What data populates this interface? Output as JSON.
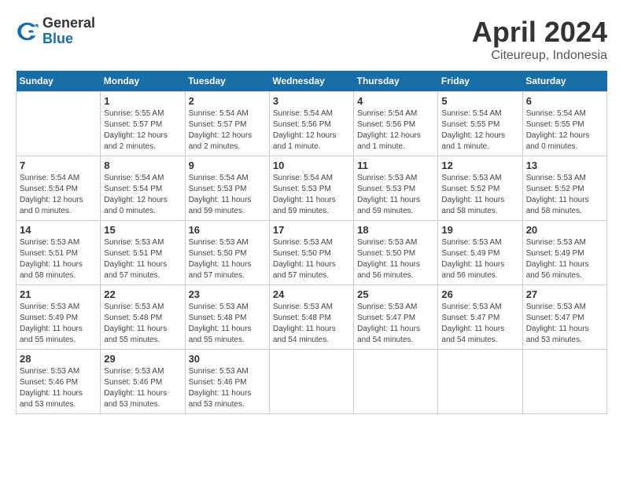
{
  "logo": {
    "general": "General",
    "blue": "Blue"
  },
  "header": {
    "month": "April 2024",
    "location": "Citeureup, Indonesia"
  },
  "weekdays": [
    "Sunday",
    "Monday",
    "Tuesday",
    "Wednesday",
    "Thursday",
    "Friday",
    "Saturday"
  ],
  "weeks": [
    [
      {
        "day": "",
        "sunrise": "",
        "sunset": "",
        "daylight": ""
      },
      {
        "day": "1",
        "sunrise": "Sunrise: 5:55 AM",
        "sunset": "Sunset: 5:57 PM",
        "daylight": "Daylight: 12 hours and 2 minutes."
      },
      {
        "day": "2",
        "sunrise": "Sunrise: 5:54 AM",
        "sunset": "Sunset: 5:57 PM",
        "daylight": "Daylight: 12 hours and 2 minutes."
      },
      {
        "day": "3",
        "sunrise": "Sunrise: 5:54 AM",
        "sunset": "Sunset: 5:56 PM",
        "daylight": "Daylight: 12 hours and 1 minute."
      },
      {
        "day": "4",
        "sunrise": "Sunrise: 5:54 AM",
        "sunset": "Sunset: 5:56 PM",
        "daylight": "Daylight: 12 hours and 1 minute."
      },
      {
        "day": "5",
        "sunrise": "Sunrise: 5:54 AM",
        "sunset": "Sunset: 5:55 PM",
        "daylight": "Daylight: 12 hours and 1 minute."
      },
      {
        "day": "6",
        "sunrise": "Sunrise: 5:54 AM",
        "sunset": "Sunset: 5:55 PM",
        "daylight": "Daylight: 12 hours and 0 minutes."
      }
    ],
    [
      {
        "day": "7",
        "sunrise": "Sunrise: 5:54 AM",
        "sunset": "Sunset: 5:54 PM",
        "daylight": "Daylight: 12 hours and 0 minutes."
      },
      {
        "day": "8",
        "sunrise": "Sunrise: 5:54 AM",
        "sunset": "Sunset: 5:54 PM",
        "daylight": "Daylight: 12 hours and 0 minutes."
      },
      {
        "day": "9",
        "sunrise": "Sunrise: 5:54 AM",
        "sunset": "Sunset: 5:53 PM",
        "daylight": "Daylight: 11 hours and 59 minutes."
      },
      {
        "day": "10",
        "sunrise": "Sunrise: 5:54 AM",
        "sunset": "Sunset: 5:53 PM",
        "daylight": "Daylight: 11 hours and 59 minutes."
      },
      {
        "day": "11",
        "sunrise": "Sunrise: 5:53 AM",
        "sunset": "Sunset: 5:53 PM",
        "daylight": "Daylight: 11 hours and 59 minutes."
      },
      {
        "day": "12",
        "sunrise": "Sunrise: 5:53 AM",
        "sunset": "Sunset: 5:52 PM",
        "daylight": "Daylight: 11 hours and 58 minutes."
      },
      {
        "day": "13",
        "sunrise": "Sunrise: 5:53 AM",
        "sunset": "Sunset: 5:52 PM",
        "daylight": "Daylight: 11 hours and 58 minutes."
      }
    ],
    [
      {
        "day": "14",
        "sunrise": "Sunrise: 5:53 AM",
        "sunset": "Sunset: 5:51 PM",
        "daylight": "Daylight: 11 hours and 58 minutes."
      },
      {
        "day": "15",
        "sunrise": "Sunrise: 5:53 AM",
        "sunset": "Sunset: 5:51 PM",
        "daylight": "Daylight: 11 hours and 57 minutes."
      },
      {
        "day": "16",
        "sunrise": "Sunrise: 5:53 AM",
        "sunset": "Sunset: 5:50 PM",
        "daylight": "Daylight: 11 hours and 57 minutes."
      },
      {
        "day": "17",
        "sunrise": "Sunrise: 5:53 AM",
        "sunset": "Sunset: 5:50 PM",
        "daylight": "Daylight: 11 hours and 57 minutes."
      },
      {
        "day": "18",
        "sunrise": "Sunrise: 5:53 AM",
        "sunset": "Sunset: 5:50 PM",
        "daylight": "Daylight: 11 hours and 56 minutes."
      },
      {
        "day": "19",
        "sunrise": "Sunrise: 5:53 AM",
        "sunset": "Sunset: 5:49 PM",
        "daylight": "Daylight: 11 hours and 56 minutes."
      },
      {
        "day": "20",
        "sunrise": "Sunrise: 5:53 AM",
        "sunset": "Sunset: 5:49 PM",
        "daylight": "Daylight: 11 hours and 56 minutes."
      }
    ],
    [
      {
        "day": "21",
        "sunrise": "Sunrise: 5:53 AM",
        "sunset": "Sunset: 5:49 PM",
        "daylight": "Daylight: 11 hours and 55 minutes."
      },
      {
        "day": "22",
        "sunrise": "Sunrise: 5:53 AM",
        "sunset": "Sunset: 5:48 PM",
        "daylight": "Daylight: 11 hours and 55 minutes."
      },
      {
        "day": "23",
        "sunrise": "Sunrise: 5:53 AM",
        "sunset": "Sunset: 5:48 PM",
        "daylight": "Daylight: 11 hours and 55 minutes."
      },
      {
        "day": "24",
        "sunrise": "Sunrise: 5:53 AM",
        "sunset": "Sunset: 5:48 PM",
        "daylight": "Daylight: 11 hours and 54 minutes."
      },
      {
        "day": "25",
        "sunrise": "Sunrise: 5:53 AM",
        "sunset": "Sunset: 5:47 PM",
        "daylight": "Daylight: 11 hours and 54 minutes."
      },
      {
        "day": "26",
        "sunrise": "Sunrise: 5:53 AM",
        "sunset": "Sunset: 5:47 PM",
        "daylight": "Daylight: 11 hours and 54 minutes."
      },
      {
        "day": "27",
        "sunrise": "Sunrise: 5:53 AM",
        "sunset": "Sunset: 5:47 PM",
        "daylight": "Daylight: 11 hours and 53 minutes."
      }
    ],
    [
      {
        "day": "28",
        "sunrise": "Sunrise: 5:53 AM",
        "sunset": "Sunset: 5:46 PM",
        "daylight": "Daylight: 11 hours and 53 minutes."
      },
      {
        "day": "29",
        "sunrise": "Sunrise: 5:53 AM",
        "sunset": "Sunset: 5:46 PM",
        "daylight": "Daylight: 11 hours and 53 minutes."
      },
      {
        "day": "30",
        "sunrise": "Sunrise: 5:53 AM",
        "sunset": "Sunset: 5:46 PM",
        "daylight": "Daylight: 11 hours and 53 minutes."
      },
      {
        "day": "",
        "sunrise": "",
        "sunset": "",
        "daylight": ""
      },
      {
        "day": "",
        "sunrise": "",
        "sunset": "",
        "daylight": ""
      },
      {
        "day": "",
        "sunrise": "",
        "sunset": "",
        "daylight": ""
      },
      {
        "day": "",
        "sunrise": "",
        "sunset": "",
        "daylight": ""
      }
    ]
  ]
}
